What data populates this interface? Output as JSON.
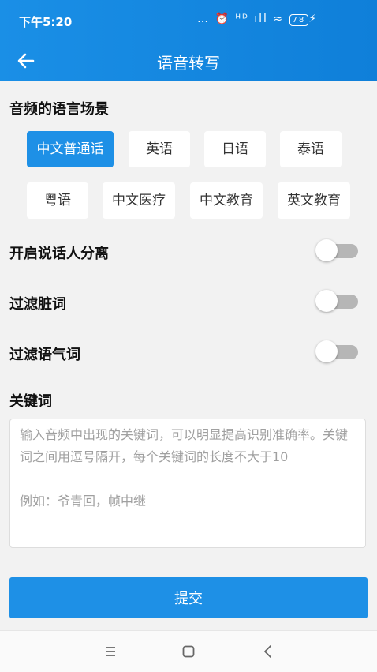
{
  "status_bar": {
    "time": "下午5:20",
    "icons": "… ⏰ ᴴᴰ ıll ≈",
    "battery": "78",
    "charging": "⚡"
  },
  "app_bar": {
    "title": "语音转写",
    "back_icon": "arrow-left-icon"
  },
  "scene": {
    "label": "音频的语言场景",
    "options": [
      "中文普通话",
      "英语",
      "日语",
      "泰语",
      "粤语",
      "中文医疗",
      "中文教育",
      "英文教育"
    ],
    "selected": "中文普通话"
  },
  "toggles": [
    {
      "label": "开启说话人分离",
      "on": false
    },
    {
      "label": "过滤脏词",
      "on": false
    },
    {
      "label": "过滤语气词",
      "on": false
    }
  ],
  "keywords": {
    "label": "关键词",
    "placeholder": "输入音频中出现的关键词，可以明显提高识别准确率。关键词之间用逗号隔开，每个关键词的长度不大于10\n\n例如：爷青回，帧中继"
  },
  "submit_label": "提交",
  "colors": {
    "accent": "#1e90e6",
    "header_start": "#1a8fe6",
    "header_end": "#0f7fd9"
  },
  "nav_icons": [
    "menu-icon",
    "home-square-icon",
    "back-chevron-icon"
  ]
}
